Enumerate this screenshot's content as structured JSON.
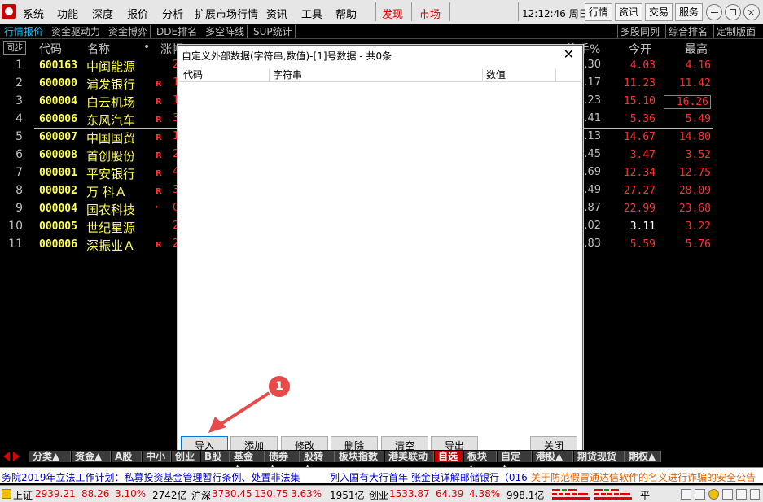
{
  "menu": {
    "items": [
      "系统",
      "功能",
      "深度",
      "报价",
      "分析",
      "扩展市场行情",
      "资讯",
      "工具",
      "帮助"
    ],
    "discover": "发现",
    "market": "市场",
    "clock": "12:12:46 周日",
    "buttons": [
      "行情",
      "资讯",
      "交易",
      "服务"
    ]
  },
  "tabs": {
    "left": [
      "行情报价",
      "资金驱动力",
      "资金博弈",
      "DDE排名",
      "多空阵线",
      "SUP统计"
    ],
    "right": [
      "多股同列",
      "综合排名",
      "定制版面"
    ]
  },
  "grid": {
    "sync_label": "同步",
    "headers": {
      "code": "代码",
      "name": "名称",
      "dot": "•",
      "change": "涨幅",
      "turnover": "换手%",
      "open": "今开",
      "high": "最高"
    },
    "rows": [
      {
        "idx": "1",
        "code": "600163",
        "name": "中闽能源",
        "r": "",
        "frag": "2",
        "frag2": ".30",
        "open": "4.03",
        "high": "4.16"
      },
      {
        "idx": "2",
        "code": "600000",
        "name": "浦发银行",
        "r": "R",
        "frag": "1",
        "frag2": ".17",
        "open": "11.23",
        "high": "11.42"
      },
      {
        "idx": "3",
        "code": "600004",
        "name": "白云机场",
        "r": "R",
        "frag": "10",
        "frag2": ".23",
        "open": "15.10",
        "high": "16.26"
      },
      {
        "idx": "4",
        "code": "600006",
        "name": "东风汽车",
        "r": "R",
        "frag": "3",
        "frag2": ".41",
        "open": "5.36",
        "high": "5.49"
      },
      {
        "idx": "5",
        "code": "600007",
        "name": "中国国贸",
        "r": "R",
        "frag": "1",
        "frag2": ".13",
        "open": "14.67",
        "high": "14.80"
      },
      {
        "idx": "6",
        "code": "600008",
        "name": "首创股份",
        "r": "R",
        "frag": "2",
        "frag2": ".45",
        "open": "3.47",
        "high": "3.52"
      },
      {
        "idx": "7",
        "code": "000001",
        "name": "平安银行",
        "r": "R",
        "frag": "4",
        "frag2": ".69",
        "open": "12.34",
        "high": "12.75"
      },
      {
        "idx": "8",
        "code": "000002",
        "name": "万 科Ａ",
        "r": "R",
        "frag": "3",
        "frag2": ".49",
        "open": "27.27",
        "high": "28.09"
      },
      {
        "idx": "9",
        "code": "000004",
        "name": "国农科技",
        "r": "'",
        "frag": "0",
        "frag2": ".87",
        "open": "22.99",
        "high": "23.68"
      },
      {
        "idx": "10",
        "code": "000005",
        "name": "世纪星源",
        "r": "",
        "frag": "2",
        "frag2": ".02",
        "open": "3.11",
        "high": "3.22"
      },
      {
        "idx": "11",
        "code": "000006",
        "name": "深振业Ａ",
        "r": "R",
        "frag": "2",
        "frag2": ".83",
        "open": "5.59",
        "high": "5.76"
      }
    ]
  },
  "dialog": {
    "title": "自定义外部数据(字符串,数值)-[1]号数据 - 共0条",
    "close": "✕",
    "columns": [
      "代码",
      "字符串",
      "数值"
    ],
    "buttons": {
      "import": "导入",
      "add": "添加",
      "modify": "修改",
      "delete": "删除",
      "clear": "清空",
      "export": "导出",
      "close": "关闭"
    }
  },
  "annotation": {
    "number": "1"
  },
  "catbar": {
    "items": [
      "分类▲",
      "资金▲",
      "A股",
      "中小",
      "创业",
      "B股",
      "基金▲",
      "债券▲",
      "股转▲",
      "板块指数",
      "港美联动",
      "自选",
      "板块▲",
      "自定▲",
      "港股▲",
      "期货现货",
      "期权▲"
    ]
  },
  "ticker": {
    "item1": "务院2019年立法工作计划：私募投资基金管理暂行条例、处置非法集",
    "item2": "列入国有大行首年 张金良详解邮储银行（016",
    "item3": "关于防范假冒通达信软件的名义进行诈骗的安全公告"
  },
  "status": {
    "sh_label": "上证",
    "sh_value": "2939.21",
    "sh_change": "88.26",
    "sh_pct": "3.10%",
    "sh_amount": "2742亿",
    "sz_label": "沪深",
    "sz_value": "3730.45",
    "sz_change": "130.75",
    "sz_pct": "3.63%",
    "sz_amount": "1951亿",
    "cy_label": "创业",
    "cy_value": "1533.87",
    "cy_change": "64.39",
    "cy_pct": "4.38%",
    "cy_amount": "998.1亿",
    "flat": "平"
  }
}
